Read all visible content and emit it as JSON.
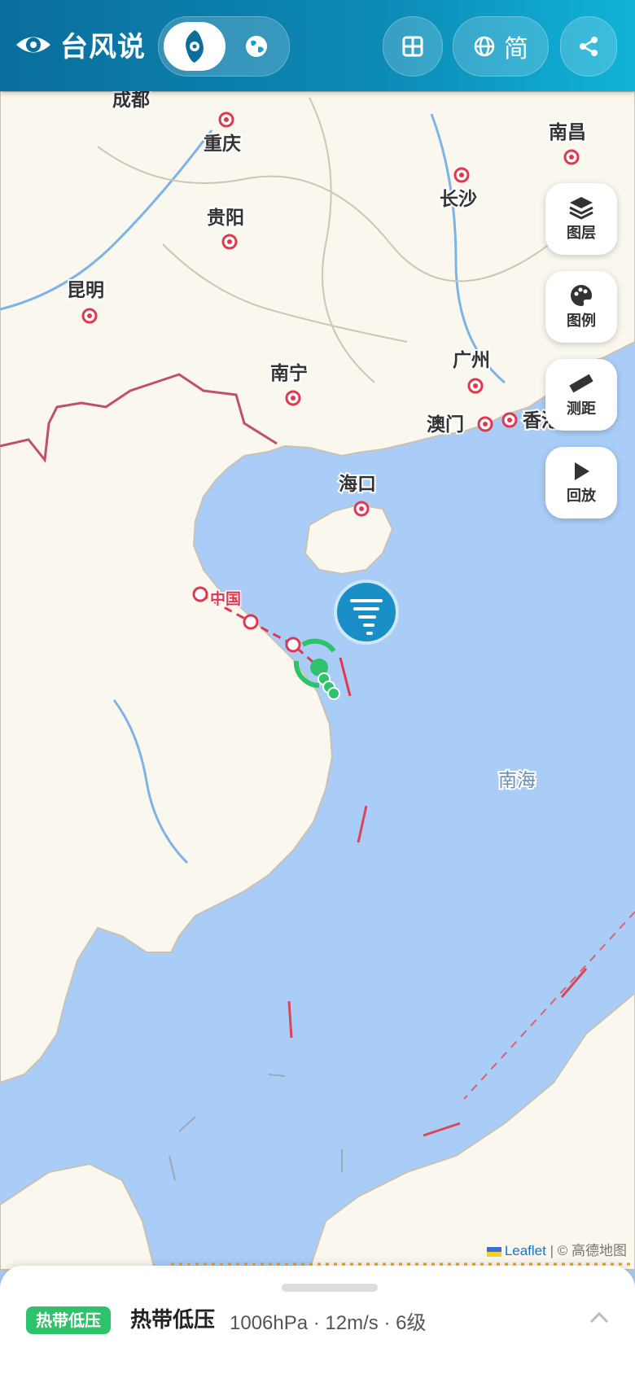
{
  "app": {
    "title": "台风说",
    "lang_label": "简"
  },
  "map_labels": {
    "chengdu": "成都",
    "chongqing": "重庆",
    "guiyang": "贵阳",
    "kunming": "昆明",
    "changsha": "长沙",
    "nanchang": "南昌",
    "nanning": "南宁",
    "guangzhou": "广州",
    "macau": "澳门",
    "hongkong": "香港",
    "haikou": "海口",
    "south_sea": "南海",
    "track_label": "中国"
  },
  "side_buttons": {
    "layers": "图层",
    "legend": "图例",
    "measure": "测距",
    "playback": "回放"
  },
  "attribution": {
    "leaflet": "Leaflet",
    "separator": "|",
    "provider": "© 高德地图"
  },
  "storm": {
    "badge": "热带低压",
    "name": "热带低压",
    "stats": "1006hPa · 12m/s · 6级"
  },
  "colors": {
    "topbar": "#0c8ab6",
    "sea": "#a9cdf7",
    "land": "#faf7ee",
    "track": "#e0394f",
    "storm": "#2ec26b"
  },
  "icons": {
    "logo": "eye-icon",
    "typhoon_mode": "typhoon-icon",
    "globe_mode": "globe-icon",
    "grid": "grid-icon",
    "lang": "globe-icon",
    "share": "share-icon"
  }
}
